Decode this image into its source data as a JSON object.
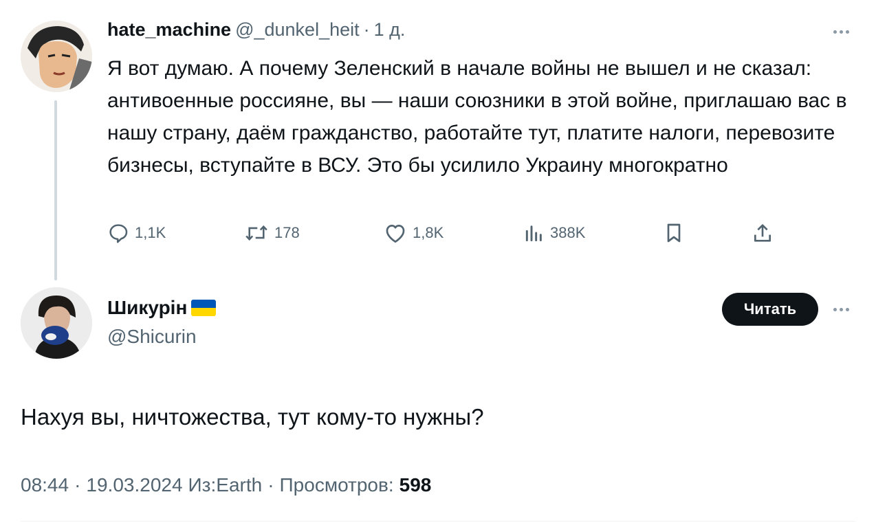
{
  "parent_tweet": {
    "display_name": "hate_machine",
    "handle": "@_dunkel_heit",
    "separator": "·",
    "time_ago": "1 д.",
    "text": "Я вот думаю. А почему Зеленский в начале войны не вышел и не сказал: антивоенные россияне, вы — наши союзники в этой войне, приглашаю вас в нашу страну, даём гражданство, работайте тут, платите налоги, перевозите бизнесы, вступайте в ВСУ. Это бы усилило Украину многократно",
    "actions": {
      "replies": "1,1K",
      "retweets": "178",
      "likes": "1,8K",
      "views": "388K"
    }
  },
  "reply_tweet": {
    "display_name": "Шикурін",
    "flag_icon": "ukraine-flag-icon",
    "handle": "@Shicurin",
    "follow_label": "Читать",
    "text": "Нахуя вы, ничтожества, тут кому-то нужны?",
    "time": "08:44",
    "date": "19.03.2024",
    "source": "Из:Earth",
    "views_label": "Просмотров:",
    "views_count": "598",
    "separator": "·"
  },
  "colors": {
    "text": "#0f1419",
    "muted": "#536471",
    "thread_line": "#cfd9de",
    "button_bg": "#0f1419",
    "flag_blue": "#0057b7",
    "flag_yellow": "#ffd700"
  }
}
